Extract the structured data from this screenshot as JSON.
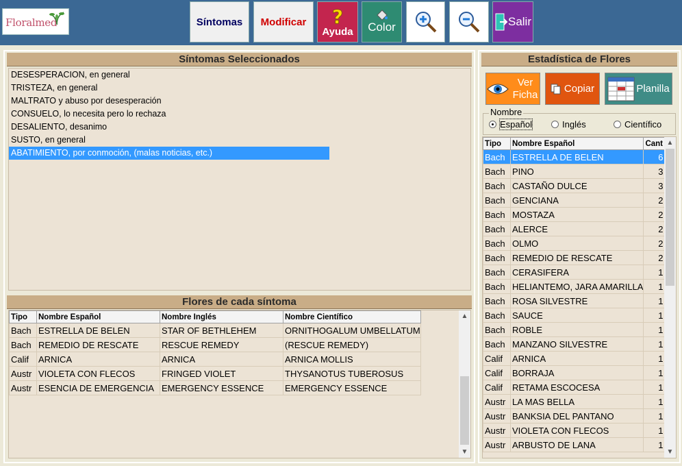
{
  "logo": {
    "text": "Floralmed"
  },
  "toolbar": {
    "sintomas": "Síntomas",
    "modificar": "Modificar",
    "ayuda": "Ayuda",
    "color": "Color",
    "salir": "Salir",
    "zoom_in_icon": "zoom-in-icon",
    "zoom_out_icon": "zoom-out-icon"
  },
  "sintomas_panel": {
    "title": "Síntomas Seleccionados",
    "items": [
      "DESESPERACION, en general",
      "TRISTEZA, en general",
      "MALTRATO y abuso por desesperación",
      "CONSUELO, lo necesita pero lo rechaza",
      "DESALIENTO, desanimo",
      "SUSTO, en general",
      "ABATIMIENTO, por conmoción, (malas noticias, etc.)"
    ],
    "selected_index": 6
  },
  "flores_panel": {
    "title": "Flores de cada síntoma",
    "columns": [
      "Tipo",
      "Nombre Español",
      "Nombre Inglés",
      "Nombre Científico"
    ],
    "rows": [
      [
        "Bach",
        "ESTRELLA DE BELEN",
        "STAR OF BETHLEHEM",
        "ORNITHOGALUM UMBELLATUM"
      ],
      [
        "Bach",
        "REMEDIO DE RESCATE",
        "RESCUE REMEDY",
        "(RESCUE REMEDY)"
      ],
      [
        "Calif",
        "ARNICA",
        "ARNICA",
        "ARNICA MOLLIS"
      ],
      [
        "Austr",
        "VIOLETA CON FLECOS",
        "FRINGED VIOLET",
        "THYSANOTUS TUBEROSUS"
      ],
      [
        "Austr",
        "ESENCIA DE EMERGENCIA",
        "EMERGENCY ESSENCE",
        "EMERGENCY ESSENCE"
      ]
    ]
  },
  "estadistica": {
    "title": "Estadística de Flores",
    "ver_ficha": "Ver Ficha",
    "copiar": "Copiar",
    "planilla": "Planilla",
    "nombre_label": "Nombre",
    "radio": [
      "Español",
      "Inglés",
      "Científico"
    ],
    "radio_selected": 0,
    "columns": [
      "Tipo",
      "Nombre Español",
      "Cant"
    ],
    "rows": [
      [
        "Bach",
        "ESTRELLA DE BELEN",
        "6"
      ],
      [
        "Bach",
        "PINO",
        "3"
      ],
      [
        "Bach",
        "CASTAÑO DULCE",
        "3"
      ],
      [
        "Bach",
        "GENCIANA",
        "2"
      ],
      [
        "Bach",
        "MOSTAZA",
        "2"
      ],
      [
        "Bach",
        "ALERCE",
        "2"
      ],
      [
        "Bach",
        "OLMO",
        "2"
      ],
      [
        "Bach",
        "REMEDIO DE RESCATE",
        "2"
      ],
      [
        "Bach",
        "CERASIFERA",
        "1"
      ],
      [
        "Bach",
        "HELIANTEMO, JARA AMARILLA",
        "1"
      ],
      [
        "Bach",
        "ROSA SILVESTRE",
        "1"
      ],
      [
        "Bach",
        "SAUCE",
        "1"
      ],
      [
        "Bach",
        "ROBLE",
        "1"
      ],
      [
        "Bach",
        "MANZANO SILVESTRE",
        "1"
      ],
      [
        "Calif",
        "ARNICA",
        "1"
      ],
      [
        "Calif",
        "BORRAJA",
        "1"
      ],
      [
        "Calif",
        "RETAMA ESCOCESA",
        "1"
      ],
      [
        "Austr",
        "LA MAS BELLA",
        "1"
      ],
      [
        "Austr",
        "BANKSIA DEL PANTANO",
        "1"
      ],
      [
        "Austr",
        "VIOLETA CON FLECOS",
        "1"
      ],
      [
        "Austr",
        "ARBUSTO DE LANA",
        "1"
      ]
    ],
    "selected_index": 0
  },
  "colors": {
    "toolbar_bg": "#3b6894",
    "selection": "#3399ff",
    "section_header": "#c9ad87",
    "panel_bg": "#ece9d8"
  }
}
